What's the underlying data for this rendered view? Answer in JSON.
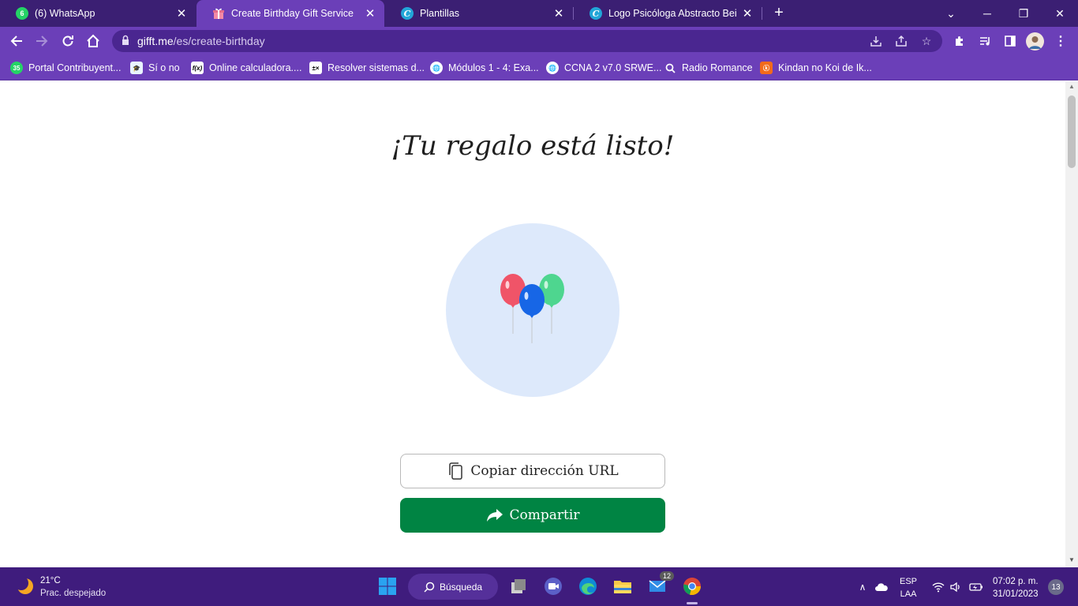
{
  "browser": {
    "tabs": [
      {
        "title": "(6) WhatsApp",
        "icon": "whatsapp-icon",
        "badge": "6"
      },
      {
        "title": "Create Birthday Gift Service",
        "icon": "gift-icon",
        "active": true
      },
      {
        "title": "Plantillas",
        "icon": "canva-icon"
      },
      {
        "title": "Logo Psicóloga Abstracto Beige",
        "icon": "canva-icon"
      }
    ],
    "url_host": "gifft.me",
    "url_path": "/es/create-birthday",
    "bookmarks": [
      {
        "label": "Portal Contribuyent...",
        "icon": "whatsapp-icon"
      },
      {
        "label": "Sí o no",
        "icon": "graduation-cap-icon"
      },
      {
        "label": "Online calculadora....",
        "icon": "function-icon"
      },
      {
        "label": "Resolver sistemas d...",
        "icon": "calculator-icon"
      },
      {
        "label": "Módulos 1 - 4: Exa...",
        "icon": "globe-icon"
      },
      {
        "label": "CCNA 2 v7.0 SRWE...",
        "icon": "globe-icon"
      },
      {
        "label": "Radio Romance",
        "icon": "search-icon"
      },
      {
        "label": "Kindan no Koi de Ik...",
        "icon": "book-icon"
      }
    ],
    "accent": "#6b3fb8",
    "tabstrip_color": "#3b1f73"
  },
  "page": {
    "headline": "¡Tu regalo está listo!",
    "copy_button": "Copiar dirección URL",
    "share_button": "Compartir",
    "share_color": "#008443",
    "circle_color": "#dde9fb"
  },
  "taskbar": {
    "weather_temp": "21°C",
    "weather_desc": "Prac. despejado",
    "search_label": "Búsqueda",
    "mail_badge": "12",
    "lang_line1": "ESP",
    "lang_line2": "LAA",
    "time": "07:02 p. m.",
    "date": "31/01/2023",
    "notifications": "13"
  }
}
